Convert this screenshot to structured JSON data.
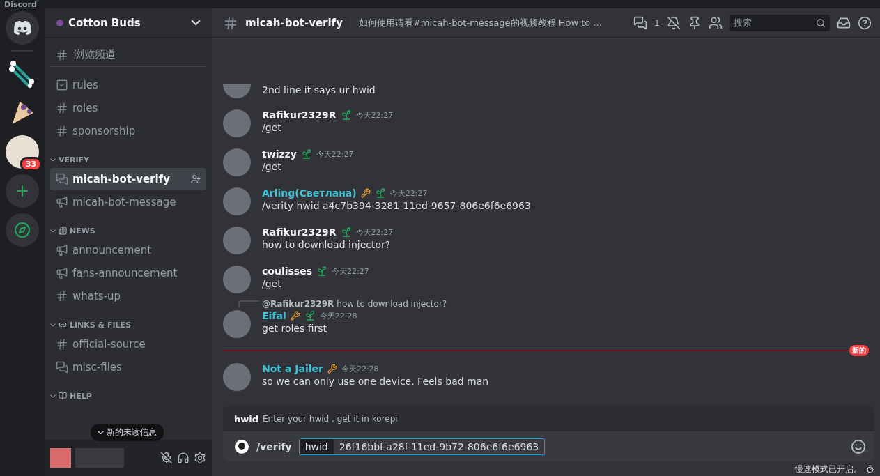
{
  "window": {
    "title": "Discord"
  },
  "servers": [
    {
      "kind": "home"
    },
    {
      "kind": "swab"
    },
    {
      "kind": "crepe"
    },
    {
      "kind": "avatar",
      "badge": "33"
    },
    {
      "kind": "add"
    },
    {
      "kind": "explore"
    }
  ],
  "server": {
    "name": "Cotton Buds"
  },
  "browse": {
    "label": "浏览频道"
  },
  "channel_groups": [
    {
      "channels": [
        {
          "kind": "rules",
          "name": "rules",
          "selected": false
        },
        {
          "kind": "text",
          "name": "roles",
          "selected": false
        },
        {
          "kind": "text",
          "name": "sponsorship",
          "selected": false
        }
      ]
    },
    {
      "category": {
        "name": "VERIFY",
        "expanded": true,
        "kind": "plain"
      },
      "channels": [
        {
          "kind": "thread",
          "name": "micah-bot-verify",
          "selected": true
        },
        {
          "kind": "announce",
          "name": "micah-bot-message",
          "selected": false
        }
      ]
    },
    {
      "category": {
        "name": "NEWS",
        "expanded": true,
        "kind": "news"
      },
      "channels": [
        {
          "kind": "announce",
          "name": "announcement",
          "selected": false
        },
        {
          "kind": "announce",
          "name": "fans-announcement",
          "selected": false
        },
        {
          "kind": "text",
          "name": "whats-up",
          "selected": false
        }
      ]
    },
    {
      "category": {
        "name": "LINKS & FILES",
        "expanded": true,
        "kind": "link"
      },
      "channels": [
        {
          "kind": "text",
          "name": "official-source",
          "selected": false
        },
        {
          "kind": "thread",
          "name": "misc-files",
          "selected": false
        }
      ]
    },
    {
      "category": {
        "name": "HELP",
        "expanded": true,
        "kind": "book"
      }
    }
  ],
  "unread_pill": "新的未读信息",
  "user_panel": {
    "mic_muted": true
  },
  "header": {
    "channel": "micah-bot-verify",
    "topic": "如何使用请看#micah-bot-message的视频教程 How to ...",
    "threads_count": "1",
    "search_placeholder": "搜索"
  },
  "messages": [
    {
      "kind": "continued",
      "text": "2nd line it says ur hwid"
    },
    {
      "kind": "message",
      "author": "Rafikur2329R",
      "color": "#f2f3f5",
      "tool": false,
      "leaf": true,
      "time": "今天22:27",
      "text": "/get"
    },
    {
      "kind": "message",
      "author": "twizzy",
      "color": "#f2f3f5",
      "tool": false,
      "leaf": true,
      "time": "今天22:27",
      "text": "/get"
    },
    {
      "kind": "message",
      "author": "Arling(Светлана)",
      "color": "#3fc1d6",
      "tool": true,
      "leaf": true,
      "time": "今天22:27",
      "text": "/verity hwid a4c7b394-3281-11ed-9657-806e6f6e6963"
    },
    {
      "kind": "message",
      "author": "Rafikur2329R",
      "color": "#f2f3f5",
      "tool": false,
      "leaf": true,
      "time": "今天22:27",
      "text": "how to download injector?"
    },
    {
      "kind": "message",
      "author": "coulisses",
      "color": "#f2f3f5",
      "tool": false,
      "leaf": true,
      "time": "今天22:27",
      "text": "/get"
    },
    {
      "kind": "message",
      "author": "Eifal",
      "color": "#3fc1d6",
      "tool": true,
      "leaf": true,
      "time": "今天22:28",
      "text": "get roles first",
      "reply": {
        "author": "@Rafikur2329R",
        "text": "how to download injector?"
      }
    },
    {
      "kind": "divider",
      "label": "新的"
    },
    {
      "kind": "message",
      "author": "Not a Jailer",
      "color": "#3fc1d6",
      "tool": true,
      "leaf": false,
      "time": "今天22:28",
      "text": "so we can only use one device. Feels bad man"
    }
  ],
  "command": {
    "option": "hwid",
    "description": "Enter your hwid , get it in korepi",
    "name": "/verify",
    "param": "hwid",
    "value": "26f16bbf-a28f-11ed-9b72-806e6f6e6963"
  },
  "slowmode": "慢速模式已开启。"
}
